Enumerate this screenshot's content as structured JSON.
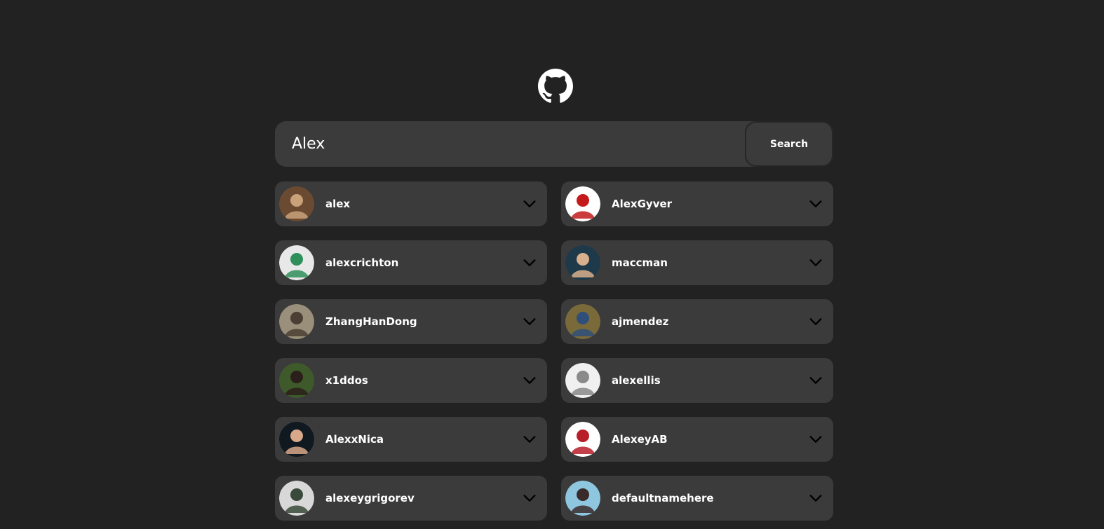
{
  "search": {
    "value": "Alex",
    "button_label": "Search"
  },
  "icons": {
    "logo": "github-icon",
    "expand": "chevron-down-icon"
  },
  "users": [
    {
      "login": "alex",
      "avatar_colors": [
        "#6b4a32",
        "#c9a27a"
      ]
    },
    {
      "login": "AlexGyver",
      "avatar_colors": [
        "#ffffff",
        "#c41a1a"
      ]
    },
    {
      "login": "alexcrichton",
      "avatar_colors": [
        "#e8e8e8",
        "#2f8f5a"
      ]
    },
    {
      "login": "maccman",
      "avatar_colors": [
        "#1e3a4a",
        "#d9b08c"
      ]
    },
    {
      "login": "ZhangHanDong",
      "avatar_colors": [
        "#9a8f7a",
        "#4a3f33"
      ]
    },
    {
      "login": "ajmendez",
      "avatar_colors": [
        "#7a6a3a",
        "#2f4f7a"
      ]
    },
    {
      "login": "x1ddos",
      "avatar_colors": [
        "#3e5a2a",
        "#2a1f1a"
      ]
    },
    {
      "login": "alexellis",
      "avatar_colors": [
        "#f0f0f0",
        "#8a8a8a"
      ]
    },
    {
      "login": "AlexxNica",
      "avatar_colors": [
        "#101820",
        "#d8a88a"
      ]
    },
    {
      "login": "AlexeyAB",
      "avatar_colors": [
        "#ffffff",
        "#b81e2a"
      ]
    },
    {
      "login": "alexeygrigorev",
      "avatar_colors": [
        "#d8d8d8",
        "#3a4a3a"
      ]
    },
    {
      "login": "defaultnamehere",
      "avatar_colors": [
        "#8ec6e0",
        "#3a2a2a"
      ]
    }
  ]
}
